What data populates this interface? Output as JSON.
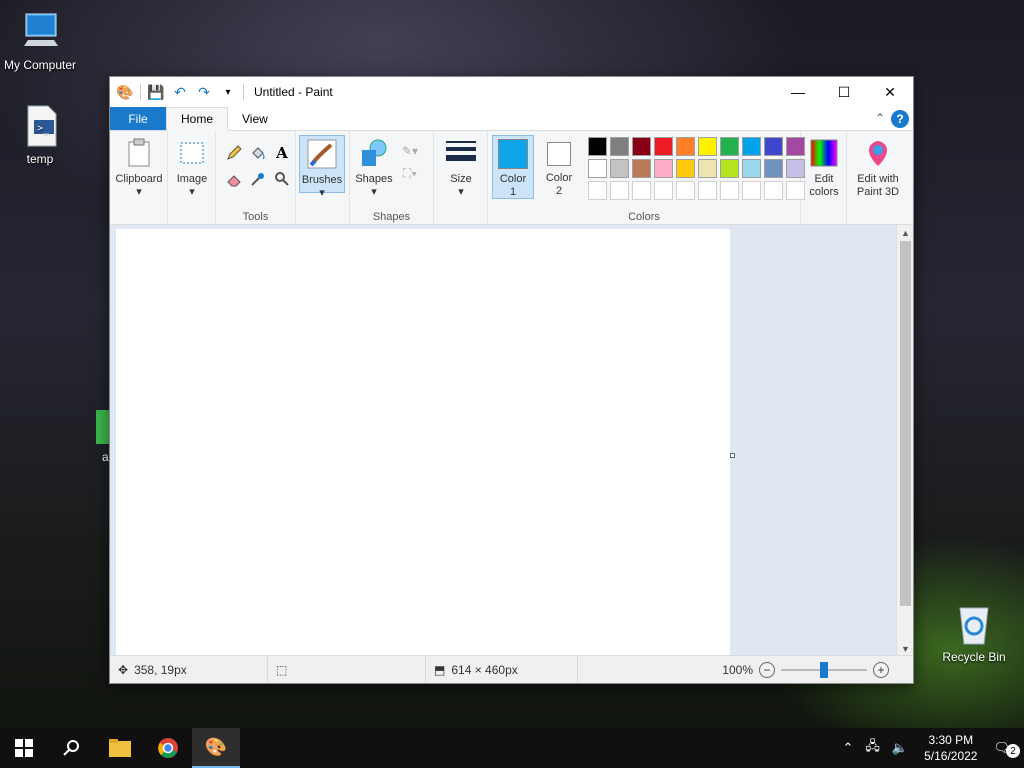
{
  "desktop": {
    "icons": [
      {
        "label": "My Computer",
        "icon": "computer-icon"
      },
      {
        "label": "temp",
        "icon": "script-file-icon"
      },
      {
        "label": "Recycle Bin",
        "icon": "recycle-bin-icon"
      }
    ],
    "partial_icon_label": "a"
  },
  "window": {
    "title": "Untitled - Paint",
    "tabs": [
      "File",
      "Home",
      "View"
    ],
    "active_tab": "Home"
  },
  "ribbon": {
    "clipboard": {
      "label": "Clipboard",
      "group": ""
    },
    "image": {
      "label": "Image"
    },
    "tools": {
      "group": "Tools"
    },
    "brushes": {
      "label": "Brushes"
    },
    "shapes": {
      "label": "Shapes",
      "group": "Shapes"
    },
    "size": {
      "label": "Size"
    },
    "color1": {
      "label_line1": "Color",
      "label_line2": "1",
      "value": "#0ea5e9"
    },
    "color2": {
      "label_line1": "Color",
      "label_line2": "2",
      "value": "#ffffff"
    },
    "colors": {
      "group": "Colors"
    },
    "edit_colors": {
      "label_line1": "Edit",
      "label_line2": "colors"
    },
    "paint3d": {
      "label_line1": "Edit with",
      "label_line2": "Paint 3D"
    },
    "palette_row1": [
      "#000000",
      "#7f7f7f",
      "#880015",
      "#ed1c24",
      "#ff7f27",
      "#fff200",
      "#22b14c",
      "#00a2e8",
      "#3f48cc",
      "#a349a4"
    ],
    "palette_row2": [
      "#ffffff",
      "#c3c3c3",
      "#b97a57",
      "#ffaec9",
      "#ffc90e",
      "#efe4b0",
      "#b5e61d",
      "#99d9ea",
      "#7092be",
      "#c8bfe7"
    ],
    "palette_row3": [
      "#ffffff",
      "#ffffff",
      "#ffffff",
      "#ffffff",
      "#ffffff",
      "#ffffff",
      "#ffffff",
      "#ffffff",
      "#ffffff",
      "#ffffff"
    ]
  },
  "canvas_note": "Canvas content omitted",
  "status": {
    "cursor_pos": "358, 19px",
    "image_size": "614 × 460px",
    "zoom": "100%",
    "zoom_fraction": 0.5
  },
  "taskbar": {
    "time": "3:30 PM",
    "date": "5/16/2022",
    "notifications": "2"
  }
}
